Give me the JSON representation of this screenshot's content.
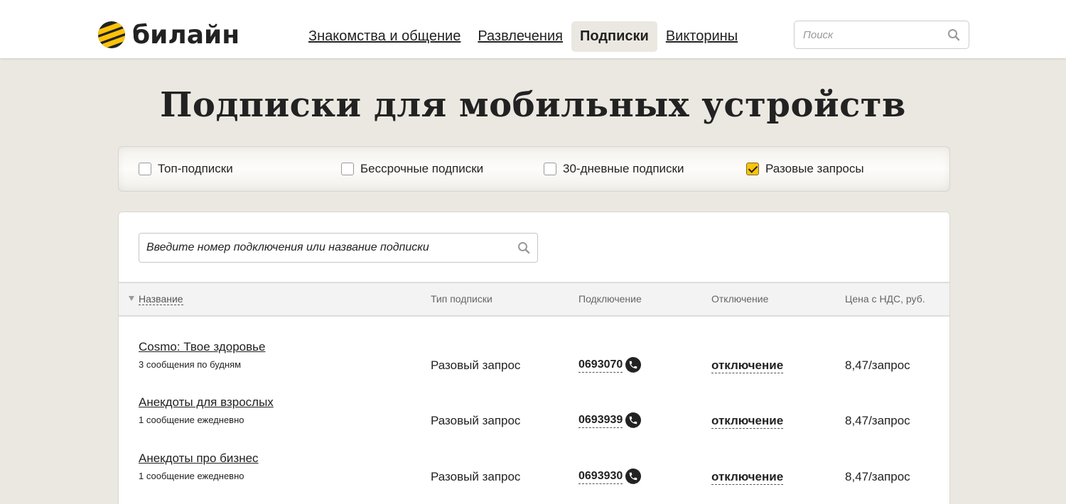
{
  "header": {
    "logo_text": "билайн",
    "nav": [
      {
        "label": "Знакомства и общение",
        "active": false
      },
      {
        "label": "Развлечения",
        "active": false
      },
      {
        "label": "Подписки",
        "active": true
      },
      {
        "label": "Викторины",
        "active": false
      }
    ],
    "search_placeholder": "Поиск"
  },
  "page_title": "Подписки для мобильных устройств",
  "filters": [
    {
      "label": "Топ-подписки",
      "checked": false
    },
    {
      "label": "Бессрочные подписки",
      "checked": false
    },
    {
      "label": "30-дневные подписки",
      "checked": false
    },
    {
      "label": "Разовые запросы",
      "checked": true
    }
  ],
  "subscription_search": {
    "placeholder": "Введите номер подключения или название подписки"
  },
  "table": {
    "columns": [
      "Название",
      "Тип подписки",
      "Подключение",
      "Отключение",
      "Цена с НДС, руб."
    ],
    "rows": [
      {
        "name": "Cosmo: Твое здоровье",
        "desc": "3 сообщения по будням",
        "type": "Разовый запрос",
        "number": "0693070",
        "off": "отключение",
        "price": "8,47/запрос"
      },
      {
        "name": "Анекдоты для взрослых",
        "desc": "1 сообщение ежедневно",
        "type": "Разовый запрос",
        "number": "0693939",
        "off": "отключение",
        "price": "8,47/запрос"
      },
      {
        "name": "Анекдоты про бизнес",
        "desc": "1 сообщение ежедневно",
        "type": "Разовый запрос",
        "number": "0693930",
        "off": "отключение",
        "price": "8,47/запрос"
      }
    ]
  },
  "colors": {
    "brand_yellow": "#fcc30b",
    "page_background": "#ebe8e1",
    "text": "#222222"
  }
}
